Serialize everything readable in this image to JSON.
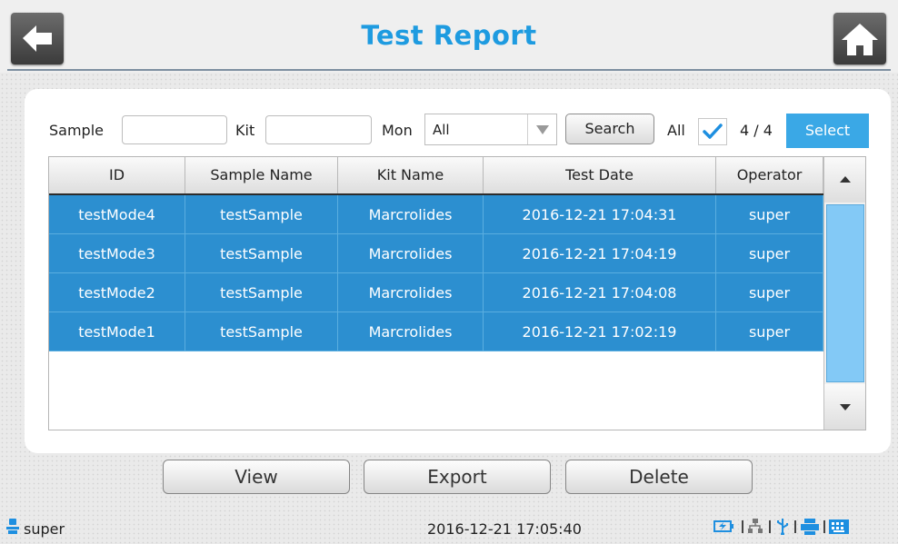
{
  "header": {
    "title": "Test Report"
  },
  "icons": {
    "back": "back-arrow-icon",
    "home": "home-icon"
  },
  "filters": {
    "sample_label": "Sample",
    "sample_value": "",
    "kit_label": "Kit",
    "kit_value": "",
    "mon_label": "Mon",
    "mon_selected": "All",
    "search_label": "Search",
    "all_label": "All",
    "all_checked": true,
    "count": "4 / 4",
    "select_label": "Select"
  },
  "table": {
    "columns": [
      "ID",
      "Sample Name",
      "Kit Name",
      "Test Date",
      "Operator"
    ],
    "rows": [
      [
        "testMode4",
        "testSample",
        "Marcrolides",
        "2016-12-21 17:04:31",
        "super"
      ],
      [
        "testMode3",
        "testSample",
        "Marcrolides",
        "2016-12-21 17:04:19",
        "super"
      ],
      [
        "testMode2",
        "testSample",
        "Marcrolides",
        "2016-12-21 17:04:08",
        "super"
      ],
      [
        "testMode1",
        "testSample",
        "Marcrolides",
        "2016-12-21 17:02:19",
        "super"
      ]
    ]
  },
  "actions": {
    "view": "View",
    "export": "Export",
    "delete": "Delete"
  },
  "status": {
    "user": "super",
    "datetime": "2016-12-21 17:05:40",
    "tray_icons": [
      "battery-charging-icon",
      "network-icon",
      "usb-icon",
      "printer-icon",
      "keyboard-icon"
    ]
  },
  "colors": {
    "accent": "#1e9be0",
    "row_selected": "#2c8fd0",
    "select_button": "#3aa8e6"
  }
}
